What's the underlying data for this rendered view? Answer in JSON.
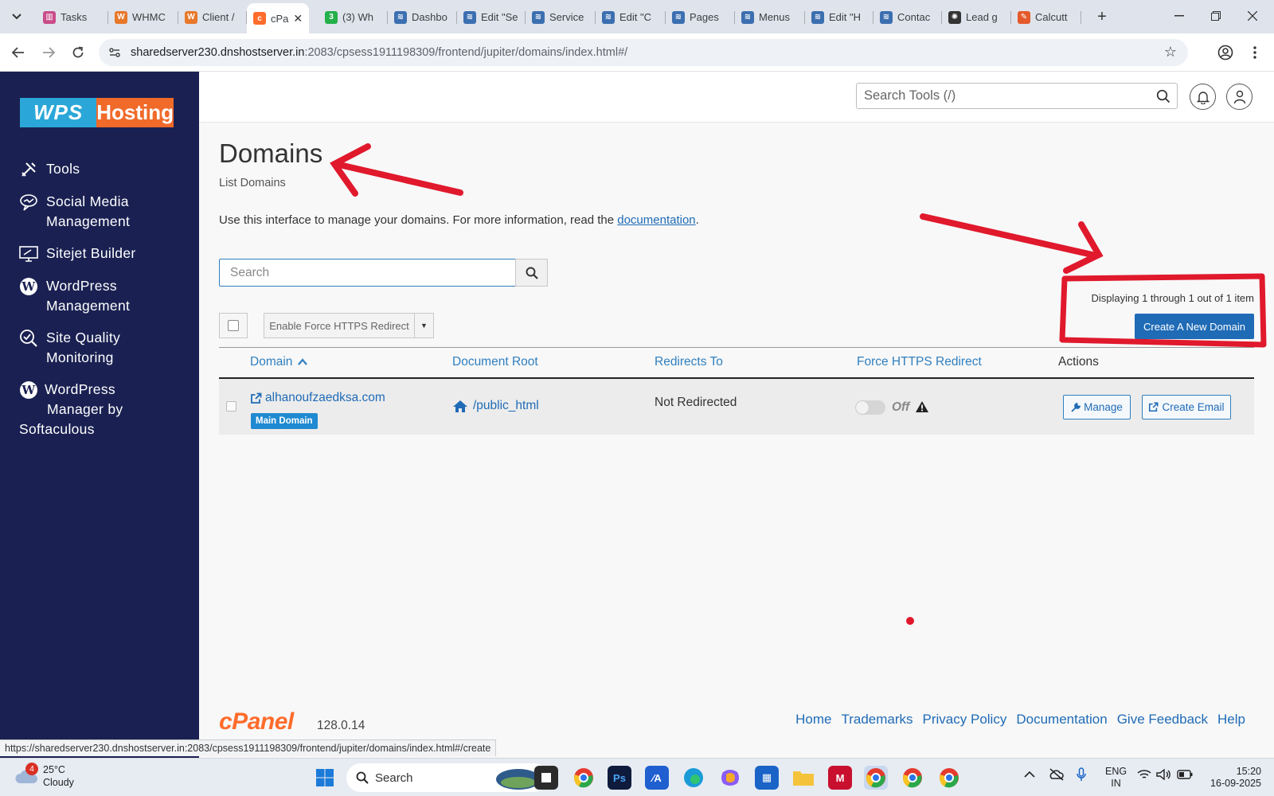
{
  "browser": {
    "tabs": [
      {
        "label": "Tasks",
        "fav_color": "#c94c8a",
        "fav_glyph": "▥"
      },
      {
        "label": "WHMC",
        "fav_color": "#e8782a",
        "fav_glyph": "W"
      },
      {
        "label": "Client /",
        "fav_color": "#e8782a",
        "fav_glyph": "W"
      },
      {
        "label": "cPa",
        "fav_color": "#ff6c2c",
        "fav_glyph": "c",
        "active": true
      },
      {
        "label": "(3) Wh",
        "fav_color": "#25b04a",
        "fav_glyph": "3"
      },
      {
        "label": "Dashbo",
        "fav_color": "#3b6fb0",
        "fav_glyph": "≋"
      },
      {
        "label": "Edit \"Se",
        "fav_color": "#3b6fb0",
        "fav_glyph": "≋"
      },
      {
        "label": "Service",
        "fav_color": "#3b6fb0",
        "fav_glyph": "≋"
      },
      {
        "label": "Edit \"C",
        "fav_color": "#3b6fb0",
        "fav_glyph": "≋"
      },
      {
        "label": "Pages",
        "fav_color": "#3b6fb0",
        "fav_glyph": "≋"
      },
      {
        "label": "Menus",
        "fav_color": "#3b6fb0",
        "fav_glyph": "≋"
      },
      {
        "label": "Edit \"H",
        "fav_color": "#3b6fb0",
        "fav_glyph": "≋"
      },
      {
        "label": "Contac",
        "fav_color": "#3b6fb0",
        "fav_glyph": "≋"
      },
      {
        "label": "Lead g",
        "fav_color": "#333333",
        "fav_glyph": "✺"
      },
      {
        "label": "Calcutt",
        "fav_color": "#e55a2b",
        "fav_glyph": "✎"
      }
    ],
    "url_host": "sharedserver230.dnshostserver.in",
    "url_path": ":2083/cpsess1911198309/frontend/jupiter/domains/index.html#/",
    "status_url": "https://sharedserver230.dnshostserver.in:2083/cpsess1911198309/frontend/jupiter/domains/index.html#/create"
  },
  "sidebar": {
    "logo_left": "WPS",
    "logo_right": "Hosting",
    "items": [
      {
        "label": "Tools",
        "icon": "tools-icon"
      },
      {
        "label": "Social Media Management",
        "line1": "Social Media",
        "line2": "Management",
        "icon": "social-icon"
      },
      {
        "label": "Sitejet Builder",
        "icon": "monitor-icon"
      },
      {
        "label": "WordPress Management",
        "line1": "WordPress",
        "line2": "Management",
        "icon": "wordpress-icon"
      },
      {
        "label": "Site Quality Monitoring",
        "line1": "Site Quality",
        "line2": "Monitoring",
        "icon": "quality-search-icon"
      },
      {
        "label": "WordPress Manager by Softaculous",
        "line1": "WordPress",
        "line2": "Manager by",
        "line3": "Softaculous",
        "icon": "wordpress-icon"
      }
    ]
  },
  "header": {
    "search_placeholder": "Search Tools (/)"
  },
  "main": {
    "title": "Domains",
    "subtitle": "List Domains",
    "intro_text": "Use this interface to manage your domains. For more information, read the ",
    "intro_link": "documentation",
    "intro_end": ".",
    "search_placeholder": "Search",
    "force_https_button": "Enable Force HTTPS Redirect",
    "displaying_text": "Displaying 1 through 1 out of 1 item",
    "create_button": "Create A New Domain",
    "columns": {
      "domain": "Domain",
      "document_root": "Document Root",
      "redirects_to": "Redirects To",
      "force_https": "Force HTTPS Redirect",
      "actions": "Actions"
    },
    "rows": [
      {
        "domain": "alhanoufzaedksa.com",
        "badge": "Main Domain",
        "document_root": "/public_html",
        "redirects_to": "Not Redirected",
        "force_https_state": "Off",
        "manage_label": "Manage",
        "create_email_label": "Create Email"
      }
    ]
  },
  "footer": {
    "brand": "cPanel",
    "version": "128.0.14",
    "links": [
      "Home",
      "Trademarks",
      "Privacy Policy",
      "Documentation",
      "Give Feedback",
      "Help"
    ]
  },
  "taskbar": {
    "weather_temp": "25°C",
    "weather_desc": "Cloudy",
    "weather_badge": "4",
    "search_label": "Search",
    "lang_top": "ENG",
    "lang_bottom": "IN",
    "time": "15:20",
    "date": "16-09-2025"
  },
  "colors": {
    "sidebar_bg": "#1a2152",
    "accent_blue": "#1f6bb6",
    "annotation_red": "#e0192c",
    "cpanel_orange": "#ff6c2c"
  }
}
